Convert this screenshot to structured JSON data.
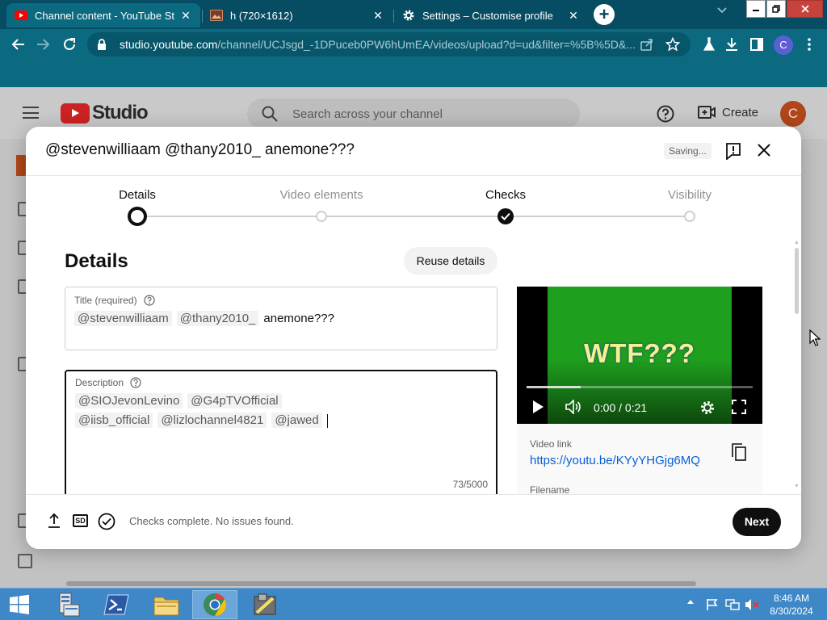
{
  "browser": {
    "tabs": [
      {
        "title": "Channel content - YouTube Studio",
        "icon": "youtube-icon"
      },
      {
        "title": "h (720×1612)",
        "icon": "image-icon"
      },
      {
        "title": "Settings – Customise profile",
        "icon": "gear-icon"
      }
    ],
    "close_glyph": "✕",
    "new_tab_glyph": "+",
    "url_host": "studio.youtube.com",
    "url_path": "/channel/UCJsgd_-1DPuceb0PW6hUmEA/videos/upload?d=ud&filter=%5B%5D&...",
    "profile_initial": "C"
  },
  "studio": {
    "logo_text": "Studio",
    "search_placeholder": "Search across your channel",
    "create_label": "Create",
    "avatar_initial": "C"
  },
  "modal": {
    "title": "@stevenwilliaam @thany2010_ anemone???",
    "saving": "Saving...",
    "steps": [
      {
        "label": "Details",
        "state": "current"
      },
      {
        "label": "Video elements",
        "state": "pending"
      },
      {
        "label": "Checks",
        "state": "done"
      },
      {
        "label": "Visibility",
        "state": "pending"
      }
    ],
    "section_title": "Details",
    "reuse_button": "Reuse details",
    "title_field": {
      "label": "Title (required)",
      "chips": [
        "@stevenwilliaam",
        "@thany2010_"
      ],
      "plain": "anemone???"
    },
    "description_field": {
      "label": "Description",
      "line1": [
        "@SIOJevonLevino",
        "@G4pTVOfficial"
      ],
      "line2": [
        "@iisb_official",
        "@lizlochannel4821",
        "@jawed"
      ],
      "counter": "73/5000"
    },
    "video": {
      "overlay_text": "WTF???",
      "time": "0:00 / 0:21",
      "progress": 0.0,
      "buffered": 0.24
    },
    "video_link_label": "Video link",
    "video_link": "https://youtu.be/KYyYHGjg6MQ",
    "filename_label": "Filename",
    "footer": {
      "sd_badge": "SD",
      "checks_text": "Checks complete. No issues found.",
      "next_button": "Next"
    }
  },
  "taskbar": {
    "time": "8:46 AM",
    "date": "8/30/2024"
  },
  "colors": {
    "chrome_dark": "#064d63",
    "chrome_toolbar": "#0b6a80",
    "youtube_red": "#cc2222",
    "link_blue": "#065fd4",
    "taskbar_blue": "#3f88c8"
  }
}
